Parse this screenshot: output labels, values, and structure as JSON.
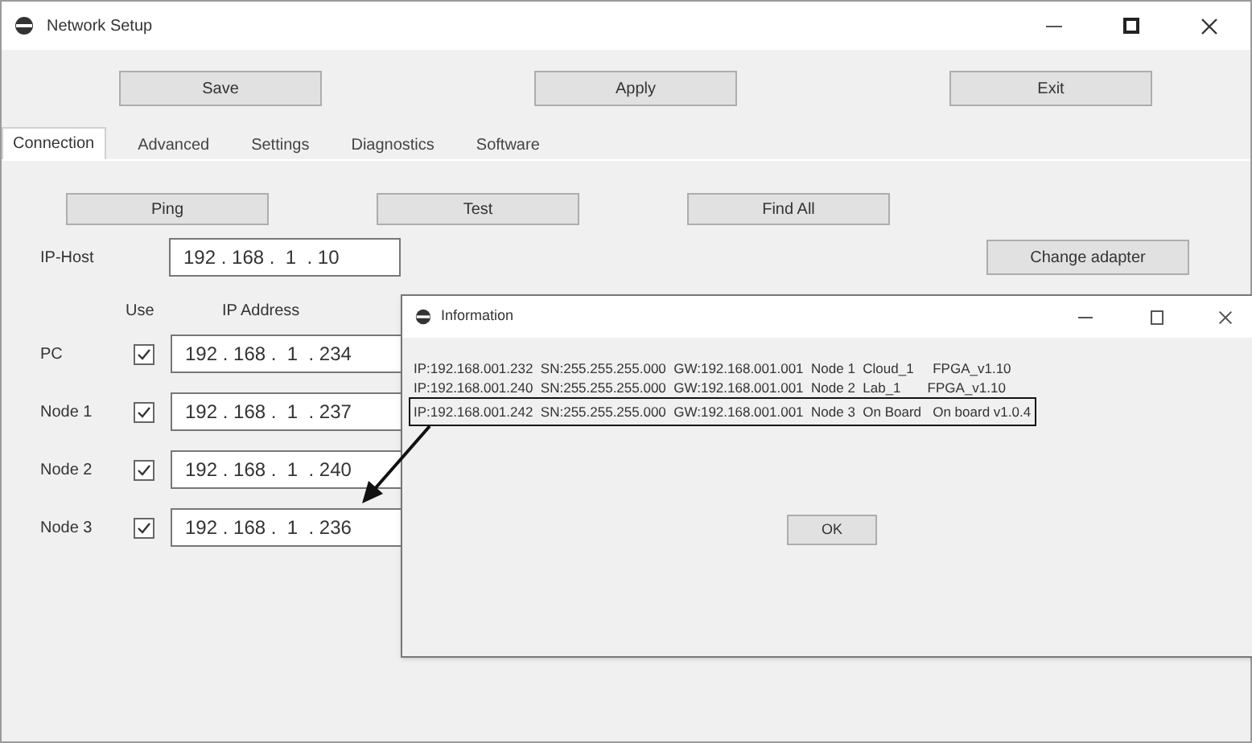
{
  "window": {
    "title": "Network Setup"
  },
  "toolbar": [
    "Save",
    "Apply",
    "Exit"
  ],
  "tabs": [
    {
      "label": "Connection",
      "selected": true
    },
    {
      "label": "Advanced",
      "selected": false
    },
    {
      "label": "Settings",
      "selected": false
    },
    {
      "label": "Diagnostics",
      "selected": false
    },
    {
      "label": "Software",
      "selected": false
    }
  ],
  "actions": [
    "Ping",
    "Test",
    "Find All"
  ],
  "host": {
    "label": "IP-Host",
    "value": "192 . 168 .  1  . 10"
  },
  "change_button": "Change adapter",
  "columns": [
    "Use",
    "IP Address"
  ],
  "nodes": [
    {
      "name": "PC",
      "checked": true,
      "ip": "192 . 168 .  1  . 234"
    },
    {
      "name": "Node 1",
      "checked": true,
      "ip": "192 . 168 .  1  . 237"
    },
    {
      "name": "Node 2",
      "checked": true,
      "ip": "192 . 168 .  1  . 240"
    },
    {
      "name": "Node 3",
      "checked": true,
      "ip": "192 . 168 .  1  . 236"
    }
  ],
  "dialog": {
    "title": "Information",
    "lines": [
      {
        "text": "IP:192.168.001.232  SN:255.255.255.000  GW:192.168.001.001  Node 1  Cloud_1     FPGA_v1.10",
        "highlighted": false
      },
      {
        "text": "IP:192.168.001.240  SN:255.255.255.000  GW:192.168.001.001  Node 2  Lab_1       FPGA_v1.10",
        "highlighted": false
      },
      {
        "text": "IP:192.168.001.242  SN:255.255.255.000  GW:192.168.001.001  Node 3  On Board   On board v1.0.4",
        "highlighted": true
      }
    ],
    "ok": "OK"
  }
}
